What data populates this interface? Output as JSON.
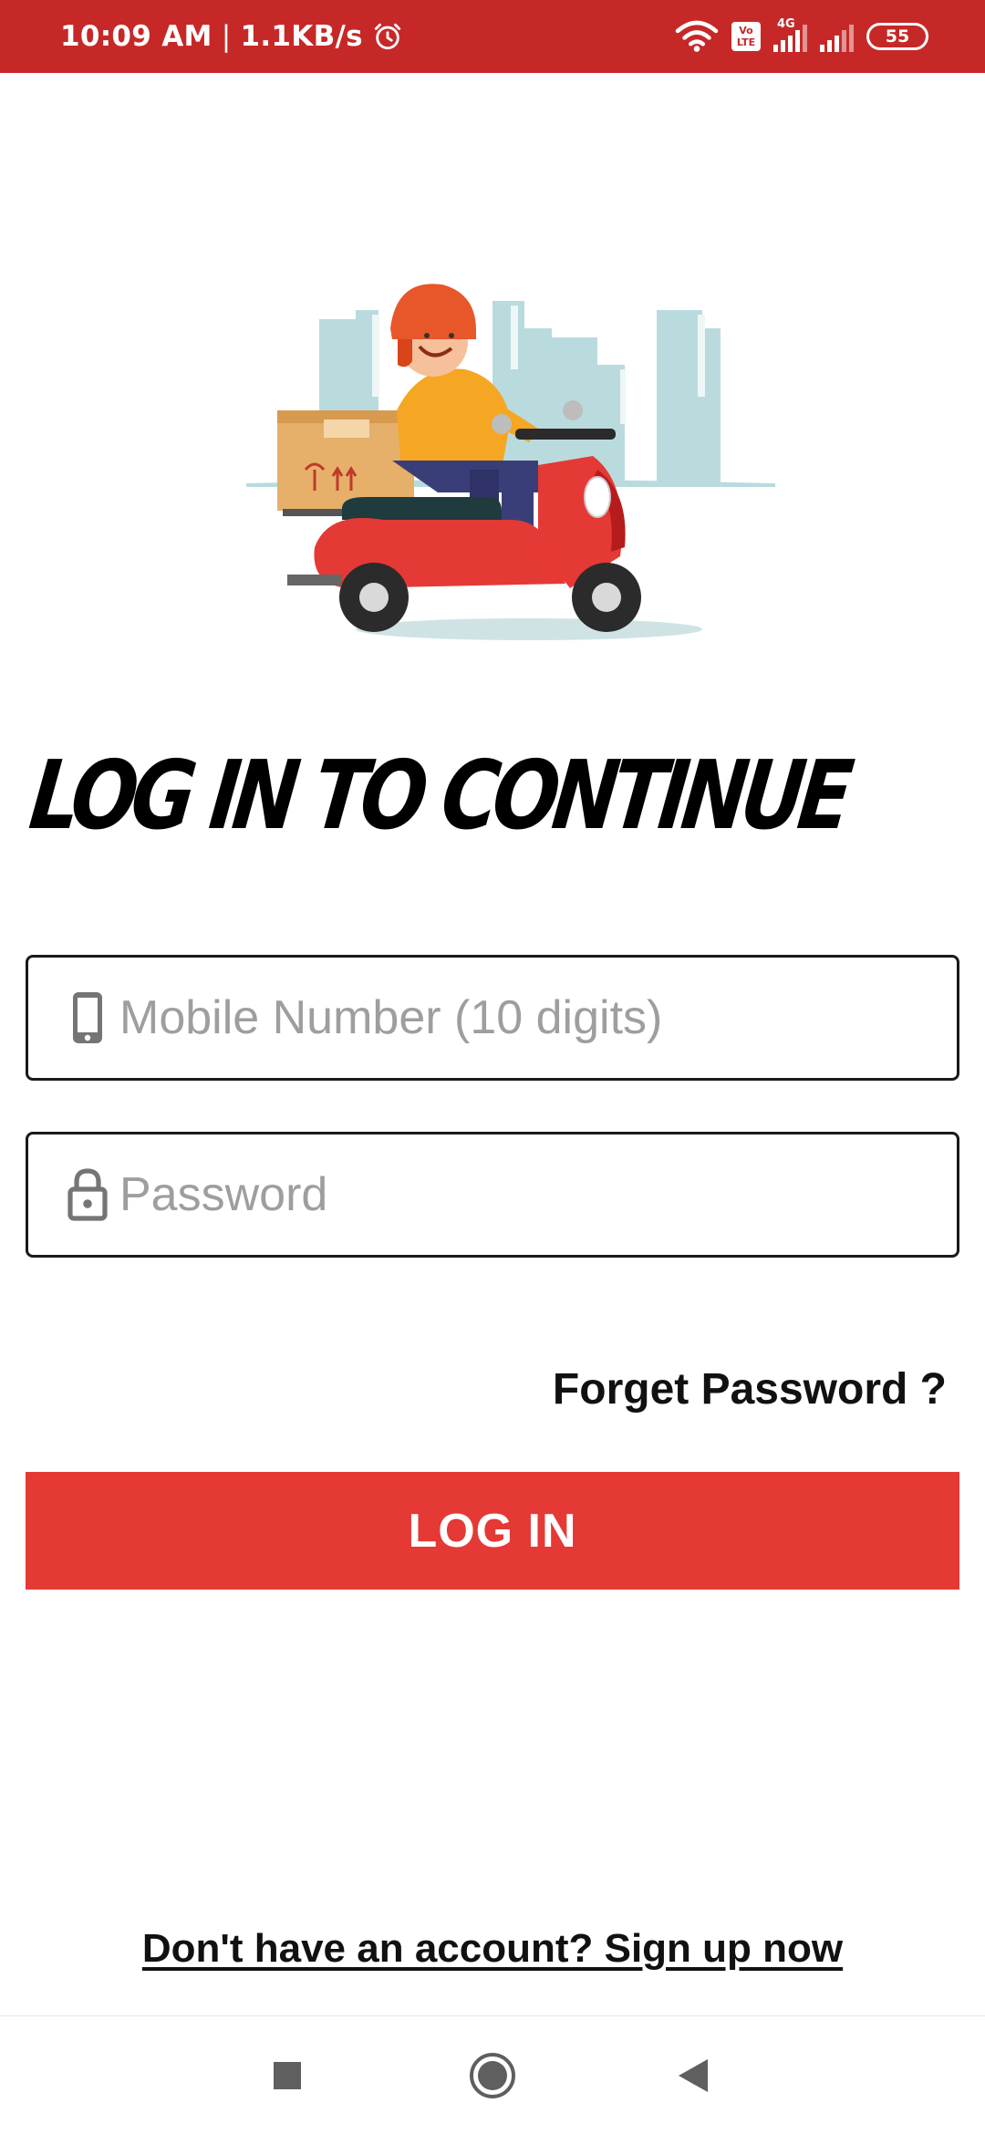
{
  "status_bar": {
    "time": "10:09 AM",
    "separator": "|",
    "network_speed": "1.1KB/s",
    "alarm_icon": "alarm-clock-icon",
    "wifi_icon": "wifi-icon",
    "volte_label_top": "Vo",
    "volte_label_bottom": "LTE",
    "network_type": "4G",
    "battery_level": "55",
    "background_color": "#c62828"
  },
  "hero": {
    "illustration": "delivery-scooter-illustration"
  },
  "title": "LOG IN TO CONTINUE",
  "form": {
    "mobile_placeholder": "Mobile Number (10 digits)",
    "mobile_icon": "mobile-phone-icon",
    "password_placeholder": "Password",
    "password_icon": "lock-icon",
    "forgot_password": "Forget Password ?",
    "login_button": "LOG IN",
    "login_button_color": "#e53935"
  },
  "signup": {
    "text": "Don't have an account? Sign up now"
  },
  "nav_bar": {
    "recents_icon": "square-recents-icon",
    "home_icon": "circle-home-icon",
    "back_icon": "triangle-back-icon"
  }
}
